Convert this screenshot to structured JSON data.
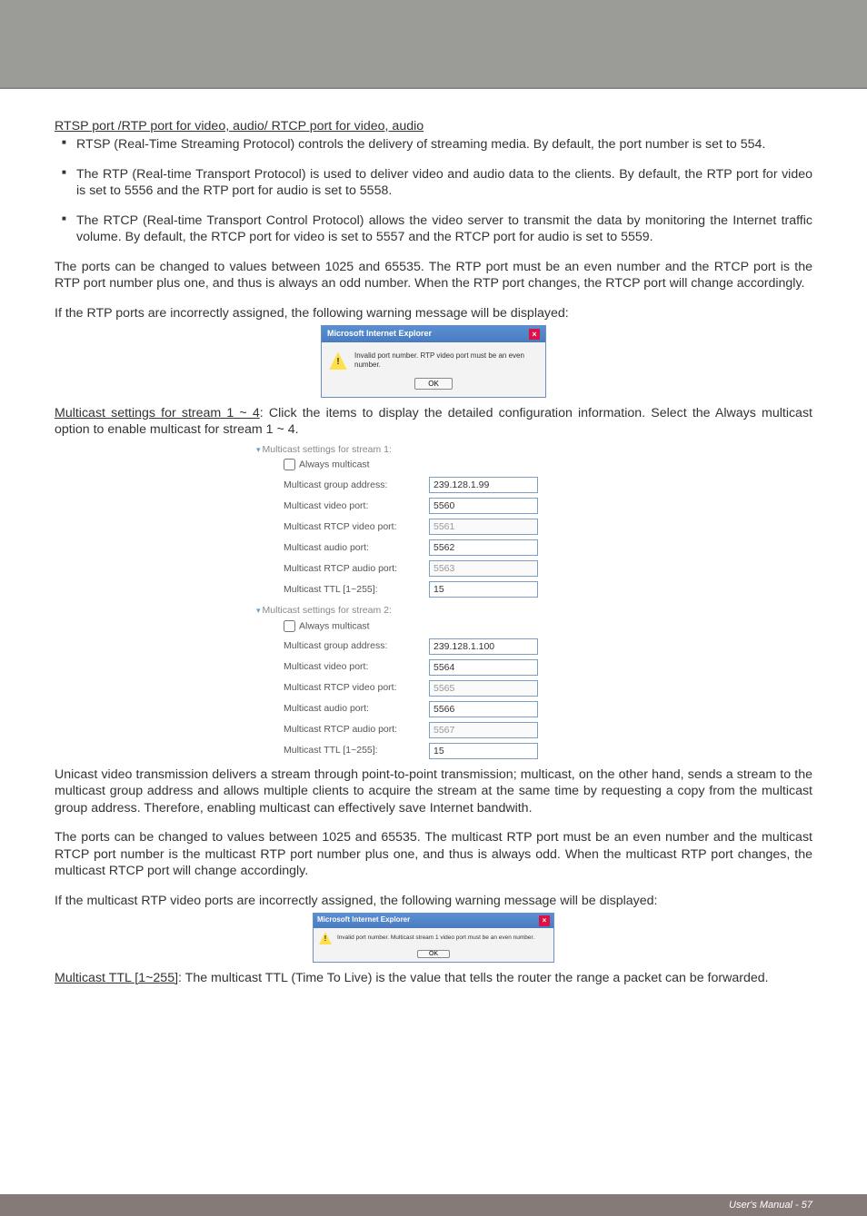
{
  "headings": {
    "rtsp": "RTSP port /RTP port for video, audio/ RTCP port for video, audio",
    "multicast_stream": "Multicast settings for stream 1 ~ 4",
    "multicast_ttl": "Multicast TTL [1~255]"
  },
  "bullets": {
    "rtsp": "RTSP (Real-Time Streaming Protocol) controls the delivery of streaming media. By default, the port number is set to 554.",
    "rtp": "The RTP (Real-time Transport Protocol) is used to deliver video and audio data to the clients. By default, the RTP port for video is set to 5556 and the RTP port for audio is set to 5558.",
    "rtcp": "The RTCP (Real-time Transport Control Protocol) allows the video server to transmit the data by monitoring the Internet traffic volume. By default, the RTCP port for video is set to 5557 and the RTCP port for audio is set to 5559."
  },
  "paras": {
    "ports_range": "The ports can be changed to values between 1025 and 65535. The RTP port must be an even number and the RTCP port is the RTP port number plus one, and thus is always an odd number. When the RTP port changes, the RTCP port will change accordingly.",
    "rtp_warn": "If the RTP ports are incorrectly assigned, the following warning message will be displayed:",
    "multicast_intro": ": Click the items to display the detailed configuration information. Select the Always multicast option to enable multicast for stream 1 ~ 4.",
    "unicast": "Unicast video transmission delivers a stream through point-to-point transmission; multicast, on the other hand, sends a stream to the multicast group address and allows multiple clients to acquire the stream at the same time by requesting a copy from the multicast group address. Therefore, enabling multicast can effectively save Internet bandwith.",
    "mcast_ports": "The ports can be changed to values between 1025 and 65535. The multicast RTP port must be an even number and the multicast RTCP port number is the multicast RTP port number plus one, and thus is always odd. When the multicast RTP port changes, the multicast RTCP port will change accordingly.",
    "mcast_warn": "If the multicast RTP video ports are incorrectly assigned, the following warning message will be displayed:",
    "ttl": ": The multicast TTL (Time To Live) is the value that tells the router the range a packet can be forwarded."
  },
  "dialog1": {
    "title": "Microsoft Internet Explorer",
    "msg": "Invalid port number. RTP video port must be an even number.",
    "ok": "OK"
  },
  "dialog2": {
    "title": "Microsoft Internet Explorer",
    "msg": "Invalid port number. Multicast stream 1 video port must be an even number.",
    "ok": "OK"
  },
  "settings": {
    "stream1": {
      "title": "Multicast settings for stream 1:",
      "always": "Always multicast",
      "rows": [
        {
          "lbl": "Multicast group address:",
          "val": "239.128.1.99",
          "disabled": false
        },
        {
          "lbl": "Multicast video port:",
          "val": "5560",
          "disabled": false
        },
        {
          "lbl": "Multicast RTCP video port:",
          "val": "5561",
          "disabled": true
        },
        {
          "lbl": "Multicast audio port:",
          "val": "5562",
          "disabled": false
        },
        {
          "lbl": "Multicast RTCP audio port:",
          "val": "5563",
          "disabled": true
        },
        {
          "lbl": "Multicast TTL [1~255]:",
          "val": "15",
          "disabled": false
        }
      ]
    },
    "stream2": {
      "title": "Multicast settings for stream 2:",
      "always": "Always multicast",
      "rows": [
        {
          "lbl": "Multicast group address:",
          "val": "239.128.1.100",
          "disabled": false
        },
        {
          "lbl": "Multicast video port:",
          "val": "5564",
          "disabled": false
        },
        {
          "lbl": "Multicast RTCP video port:",
          "val": "5565",
          "disabled": true
        },
        {
          "lbl": "Multicast audio port:",
          "val": "5566",
          "disabled": false
        },
        {
          "lbl": "Multicast RTCP audio port:",
          "val": "5567",
          "disabled": true
        },
        {
          "lbl": "Multicast TTL [1~255]:",
          "val": "15",
          "disabled": false
        }
      ]
    }
  },
  "footer": "User's Manual - 57"
}
